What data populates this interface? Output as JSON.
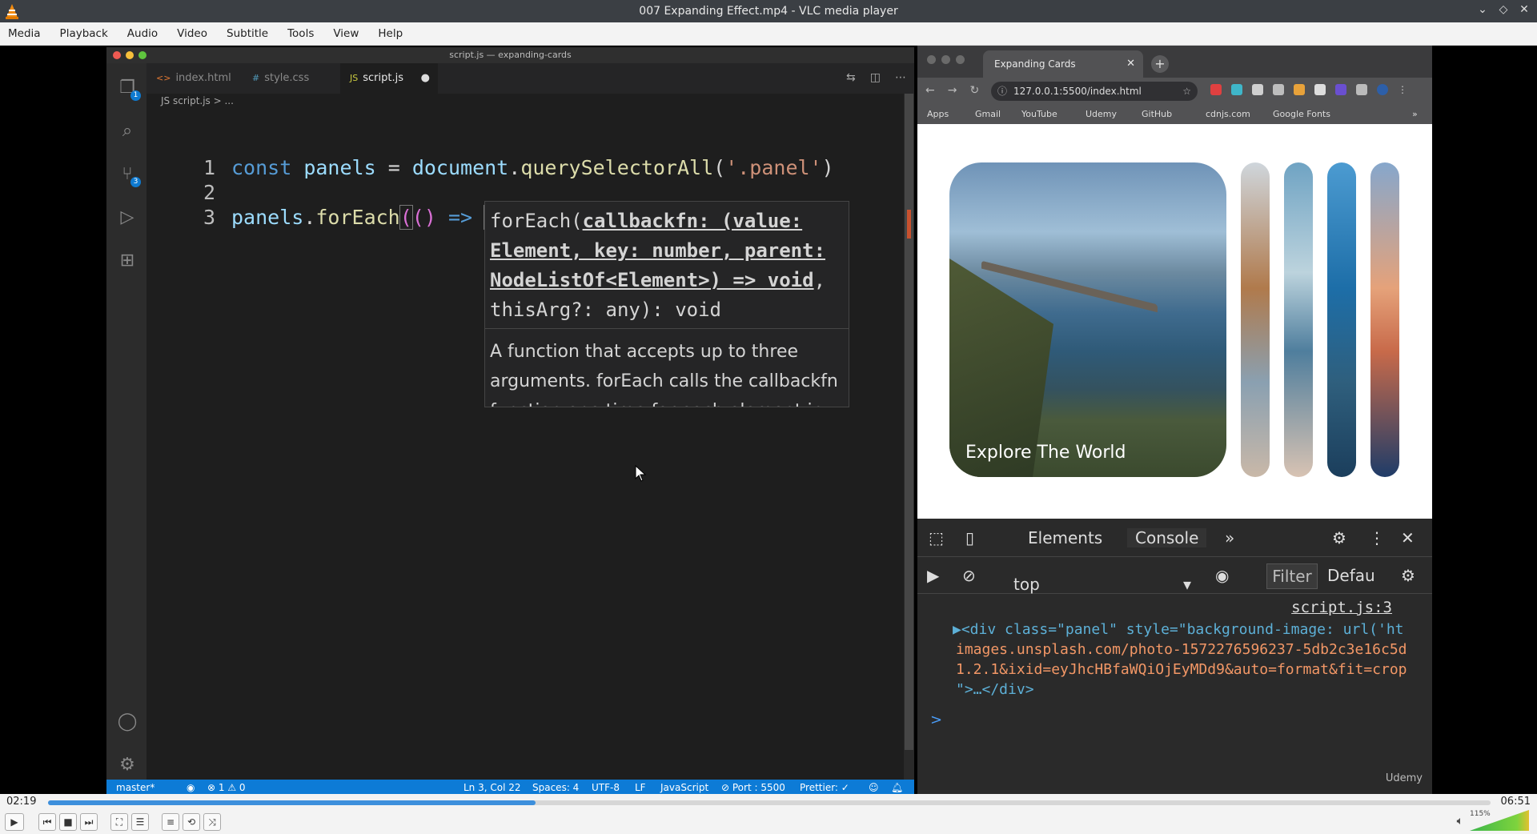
{
  "window": {
    "title": "007 Expanding Effect.mp4 - VLC media player"
  },
  "menu": [
    "Media",
    "Playback",
    "Audio",
    "Video",
    "Subtitle",
    "Tools",
    "View",
    "Help"
  ],
  "vscode": {
    "title": "script.js — expanding-cards",
    "tabs": [
      {
        "icon": "<>",
        "label": "index.html"
      },
      {
        "icon": "#",
        "label": "style.css"
      },
      {
        "icon": "JS",
        "label": "script.js",
        "modified_dot": "●"
      }
    ],
    "breadcrumb": "JS script.js > ...",
    "activity_badges": {
      "explorer": "1",
      "source_control": "3"
    },
    "lines": [
      {
        "number": "1",
        "text": "const panels = document.querySelectorAll('.panel')"
      },
      {
        "number": "2",
        "text": ""
      },
      {
        "number": "3",
        "text": "panels.forEach(() => )"
      }
    ],
    "hover": {
      "signature_start": "forEach(",
      "signature_param": "callbackfn: (value: Element, key: number, parent: NodeListOf<Element>) => void",
      "signature_end": ", thisArg?: any): void",
      "doc": "A function that accepts up to three arguments. forEach calls the callbackfn function one time for each element in the"
    },
    "status": {
      "branch": "master*",
      "problems": "⊗ 1 ⚠ 0",
      "position": "Ln 3, Col 22",
      "spaces": "Spaces: 4",
      "encoding": "UTF-8",
      "eol": "LF",
      "language": "JavaScript",
      "port": "⊘ Port : 5500",
      "prettier": "Prettier: ✓"
    }
  },
  "browser": {
    "tab_title": "Expanding Cards",
    "url": "127.0.0.1:5500/index.html",
    "bookmarks": [
      "Apps",
      "Gmail",
      "YouTube",
      "Udemy",
      "GitHub",
      "cdnjs.com",
      "Google Fonts"
    ],
    "panel_label": "Explore The World",
    "devtools": {
      "tabs": [
        "Elements",
        "Console"
      ],
      "context": "top",
      "filter": "Filter",
      "levels": "Defau",
      "source": "script.js:3",
      "log_lines": [
        "▶<div class=\"panel\" style=\"background-image: url('ht",
        "images.unsplash.com/photo-1572276596237-5db2c3e16c5d",
        "1.2.1&ixid=eyJhcHBfaWQiOjEyMDd9&auto=format&fit=crop",
        "\">…</div>"
      ],
      "prompt": ">"
    },
    "watermark": "Udemy"
  },
  "player": {
    "time_current": "02:19",
    "time_total": "06:51",
    "progress": 0.338,
    "volume_label": "115%",
    "volume_level": 1.0
  },
  "colors": {
    "vscode_status": "#0d7bd6",
    "seek_fill": "#3d8fdc"
  }
}
